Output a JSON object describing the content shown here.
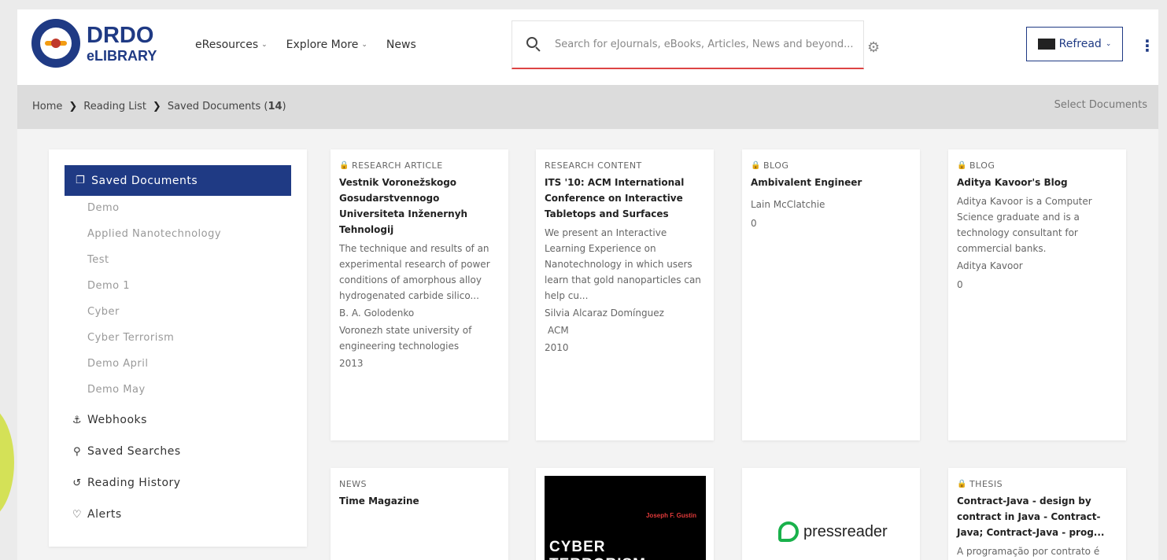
{
  "header": {
    "logo_title": "DRDO",
    "logo_sub": "eLIBRARY",
    "nav": [
      {
        "label": "eResources",
        "has_caret": true
      },
      {
        "label": "Explore More",
        "has_caret": true
      },
      {
        "label": "News",
        "has_caret": false
      }
    ],
    "search_placeholder": "Search for eJournals, eBooks, Articles, News and beyond...",
    "user_label": "Refread",
    "icons": {
      "search": "search-icon",
      "settings": "gear-icon",
      "menu": "kebab-menu-icon"
    }
  },
  "breadcrumb": {
    "home": "Home",
    "reading_list": "Reading List",
    "current": "Saved Documents (",
    "count": "14",
    "close": ")",
    "select_documents": "Select Documents"
  },
  "sidebar": {
    "active": "Saved Documents",
    "sublists": [
      "Demo",
      "Applied Nanotechnology",
      "Test",
      "Demo 1",
      "Cyber",
      "Cyber Terrorism",
      "Demo April",
      "Demo May"
    ],
    "main": [
      {
        "label": "Webhooks",
        "icon": "anchor-icon"
      },
      {
        "label": "Saved Searches",
        "icon": "search-plus-icon"
      },
      {
        "label": "Reading History",
        "icon": "history-icon"
      },
      {
        "label": "Alerts",
        "icon": "bell-icon"
      }
    ]
  },
  "cards": [
    {
      "type": "RESEARCH ARTICLE",
      "title": "Vestnik Voronežskogo Gosudarstvennogo Universiteta Inženernyh Tehnologij",
      "desc": "The technique and results of an experimental research of power conditions of amorphous alloy hydrogenated carbide silico...",
      "author": "B. A. Golodenko",
      "publisher": "Voronezh state university of engineering technologies",
      "year": "2013"
    },
    {
      "type": "RESEARCH CONTENT",
      "title": "ITS '10: ACM International Conference on Interactive Tabletops and Surfaces",
      "desc": "We present an Interactive Learning Experience on Nanotechnology in which users learn that gold nanoparticles can help cu...",
      "author": "Silvia Alcaraz Domínguez",
      "publisher": "ACM",
      "year": "2010"
    },
    {
      "type": "BLOG",
      "title": "Ambivalent Engineer",
      "author": "Lain McClatchie",
      "count": "0"
    },
    {
      "type": "BLOG",
      "title": "Aditya Kavoor's Blog",
      "desc": "Aditya Kavoor is a Computer Science graduate and is a technology consultant for commercial banks.",
      "author": "Aditya Kavoor",
      "count": "0"
    },
    {
      "type": "NEWS",
      "title": "Time Magazine"
    },
    {
      "cover_author": "Joseph F. Gustin",
      "cover_title": "CYBER TERRORISM"
    },
    {
      "logo_text": "pressreader"
    },
    {
      "type": "THESIS",
      "title": "Contract-Java - design by contract in Java - Contract-Java; Contract-Java - prog...",
      "desc": "A programação por contrato é"
    }
  ]
}
